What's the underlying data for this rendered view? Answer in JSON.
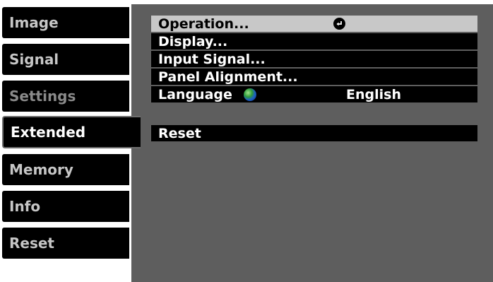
{
  "sidebar": {
    "tabs": [
      {
        "label": "Image"
      },
      {
        "label": "Signal"
      },
      {
        "label": "Settings"
      },
      {
        "label": "Extended"
      },
      {
        "label": "Memory"
      },
      {
        "label": "Info"
      },
      {
        "label": "Reset"
      }
    ],
    "active_tab": "Extended"
  },
  "menu": {
    "items": [
      {
        "label": "Operation...",
        "selected": true,
        "icon": "enter-icon"
      },
      {
        "label": "Display..."
      },
      {
        "label": "Input Signal..."
      },
      {
        "label": "Panel Alignment..."
      },
      {
        "label": "Language",
        "icon": "globe-icon",
        "value": "English"
      }
    ],
    "reset_label": "Reset"
  },
  "colors": {
    "panel_background": "#5e5e5e",
    "row_background": "#000000",
    "selected_row_background": "#c8c8c8",
    "tab_text": "#c6c6c6",
    "dim_tab_text": "#8a8a8a"
  }
}
